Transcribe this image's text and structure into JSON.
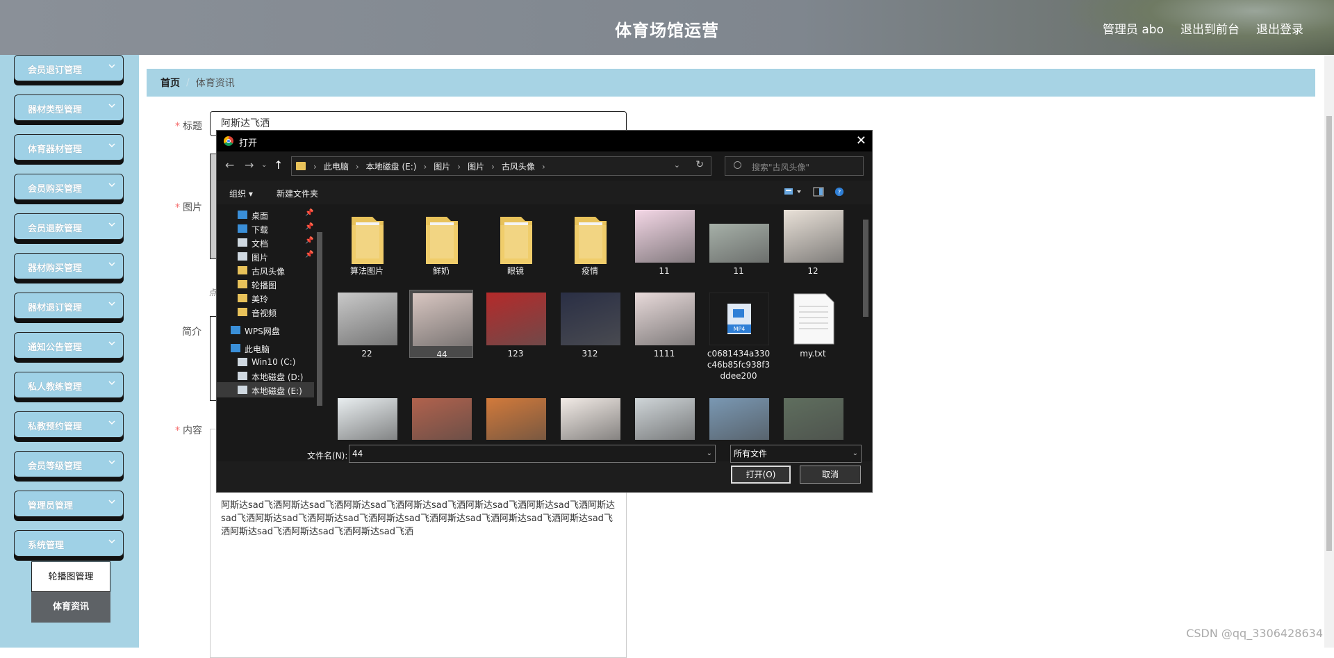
{
  "header": {
    "title": "体育场馆运营",
    "links": [
      "管理员 abo",
      "退出到前台",
      "退出登录"
    ]
  },
  "sidebar": {
    "items": [
      "会员退订管理",
      "器材类型管理",
      "体育器材管理",
      "会员购买管理",
      "会员退款管理",
      "器材购买管理",
      "器材退订管理",
      "通知公告管理",
      "私人教练管理",
      "私教预约管理",
      "会员等级管理",
      "管理员管理",
      "系统管理"
    ],
    "submenu": [
      "轮播图管理",
      "体育资讯"
    ]
  },
  "breadcrumb": {
    "home": "首页",
    "sep": "/",
    "current": "体育资讯"
  },
  "form": {
    "title_label": "标题",
    "title_value": "阿斯达飞洒",
    "image_label": "图片",
    "note": "点",
    "intro_label": "简介",
    "content_label": "内容",
    "content_text": "阿斯达sad飞洒阿斯达sad飞洒阿斯达sad飞洒阿斯达sad飞洒阿斯达sad飞洒阿斯达sad飞洒阿斯达sad飞洒阿斯达sad飞洒阿斯达sad飞洒阿斯达sad飞洒阿斯达sad飞洒阿斯达sad飞洒阿斯达sad飞洒阿斯达sad飞洒阿斯达sad飞洒阿斯达sad飞洒"
  },
  "watermark": "CSDN @qq_3306428634",
  "dialog": {
    "title": "打开",
    "close": "✕",
    "path": [
      "此电脑",
      "本地磁盘 (E:)",
      "图片",
      "图片",
      "古风头像"
    ],
    "search_placeholder": "搜索\"古风头像\"",
    "organize": "组织 ▾",
    "new_folder": "新建文件夹",
    "nav": [
      {
        "label": "桌面",
        "pin": true
      },
      {
        "label": "下载",
        "pin": true
      },
      {
        "label": "文档",
        "pin": true
      },
      {
        "label": "图片",
        "pin": true
      },
      {
        "label": "古风头像",
        "pin": false
      },
      {
        "label": "轮播图",
        "pin": false
      },
      {
        "label": "美玲",
        "pin": false
      },
      {
        "label": "音视频",
        "pin": false
      },
      {
        "label": "WPS网盘",
        "pin": false
      },
      {
        "label": "此电脑",
        "pin": false
      },
      {
        "label": "Win10 (C:)",
        "pin": false
      },
      {
        "label": "本地磁盘 (D:)",
        "pin": false
      },
      {
        "label": "本地磁盘 (E:)",
        "pin": false
      }
    ],
    "files": [
      {
        "name": "算法图片",
        "kind": "folder"
      },
      {
        "name": "鲜奶",
        "kind": "folder"
      },
      {
        "name": "眼镜",
        "kind": "folder"
      },
      {
        "name": "疫情",
        "kind": "folder"
      },
      {
        "name": "11",
        "kind": "image"
      },
      {
        "name": "11",
        "kind": "image"
      },
      {
        "name": "12",
        "kind": "image"
      },
      {
        "name": "22",
        "kind": "image"
      },
      {
        "name": "44",
        "kind": "image"
      },
      {
        "name": "123",
        "kind": "image"
      },
      {
        "name": "312",
        "kind": "image"
      },
      {
        "name": "1111",
        "kind": "image"
      },
      {
        "name": "c0681434a330c46b85fc938f3ddee200",
        "kind": "video"
      },
      {
        "name": "my.txt",
        "kind": "text"
      }
    ],
    "filename_label": "文件名(N):",
    "filename_value": "44",
    "filetype": "所有文件",
    "open_btn": "打开(O)",
    "cancel_btn": "取消"
  }
}
